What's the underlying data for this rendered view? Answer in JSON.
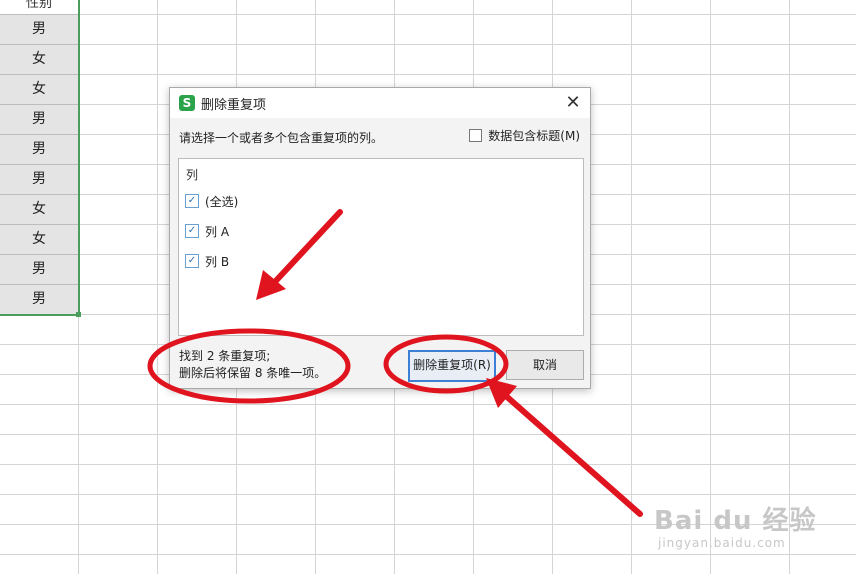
{
  "sheet": {
    "column_header": "性别",
    "rows": [
      "男",
      "女",
      "女",
      "男",
      "男",
      "男",
      "女",
      "女",
      "男",
      "男"
    ]
  },
  "dialog": {
    "title": "删除重复项",
    "app_icon": "S",
    "close_glyph": "✕",
    "instruction": "请选择一个或者多个包含重复项的列。",
    "header_checkbox_label": "数据包含标题(M)",
    "header_checkbox_checked": false,
    "list_header": "列",
    "items": [
      {
        "label": "(全选)",
        "checked": true
      },
      {
        "label": "列 A",
        "checked": true
      },
      {
        "label": "列 B",
        "checked": true
      }
    ],
    "status_line1": "找到 2 条重复项;",
    "status_line2": "删除后将保留 8 条唯一项。",
    "remove_button": "删除重复项(R)",
    "cancel_button": "取消"
  },
  "watermark": {
    "logo": "Bai du 经验",
    "url": "jingyan.baidu.com"
  },
  "colors": {
    "accent_green": "#4a9d5a",
    "annotation_red": "#e0141e",
    "primary_border": "#3c7fd4"
  }
}
